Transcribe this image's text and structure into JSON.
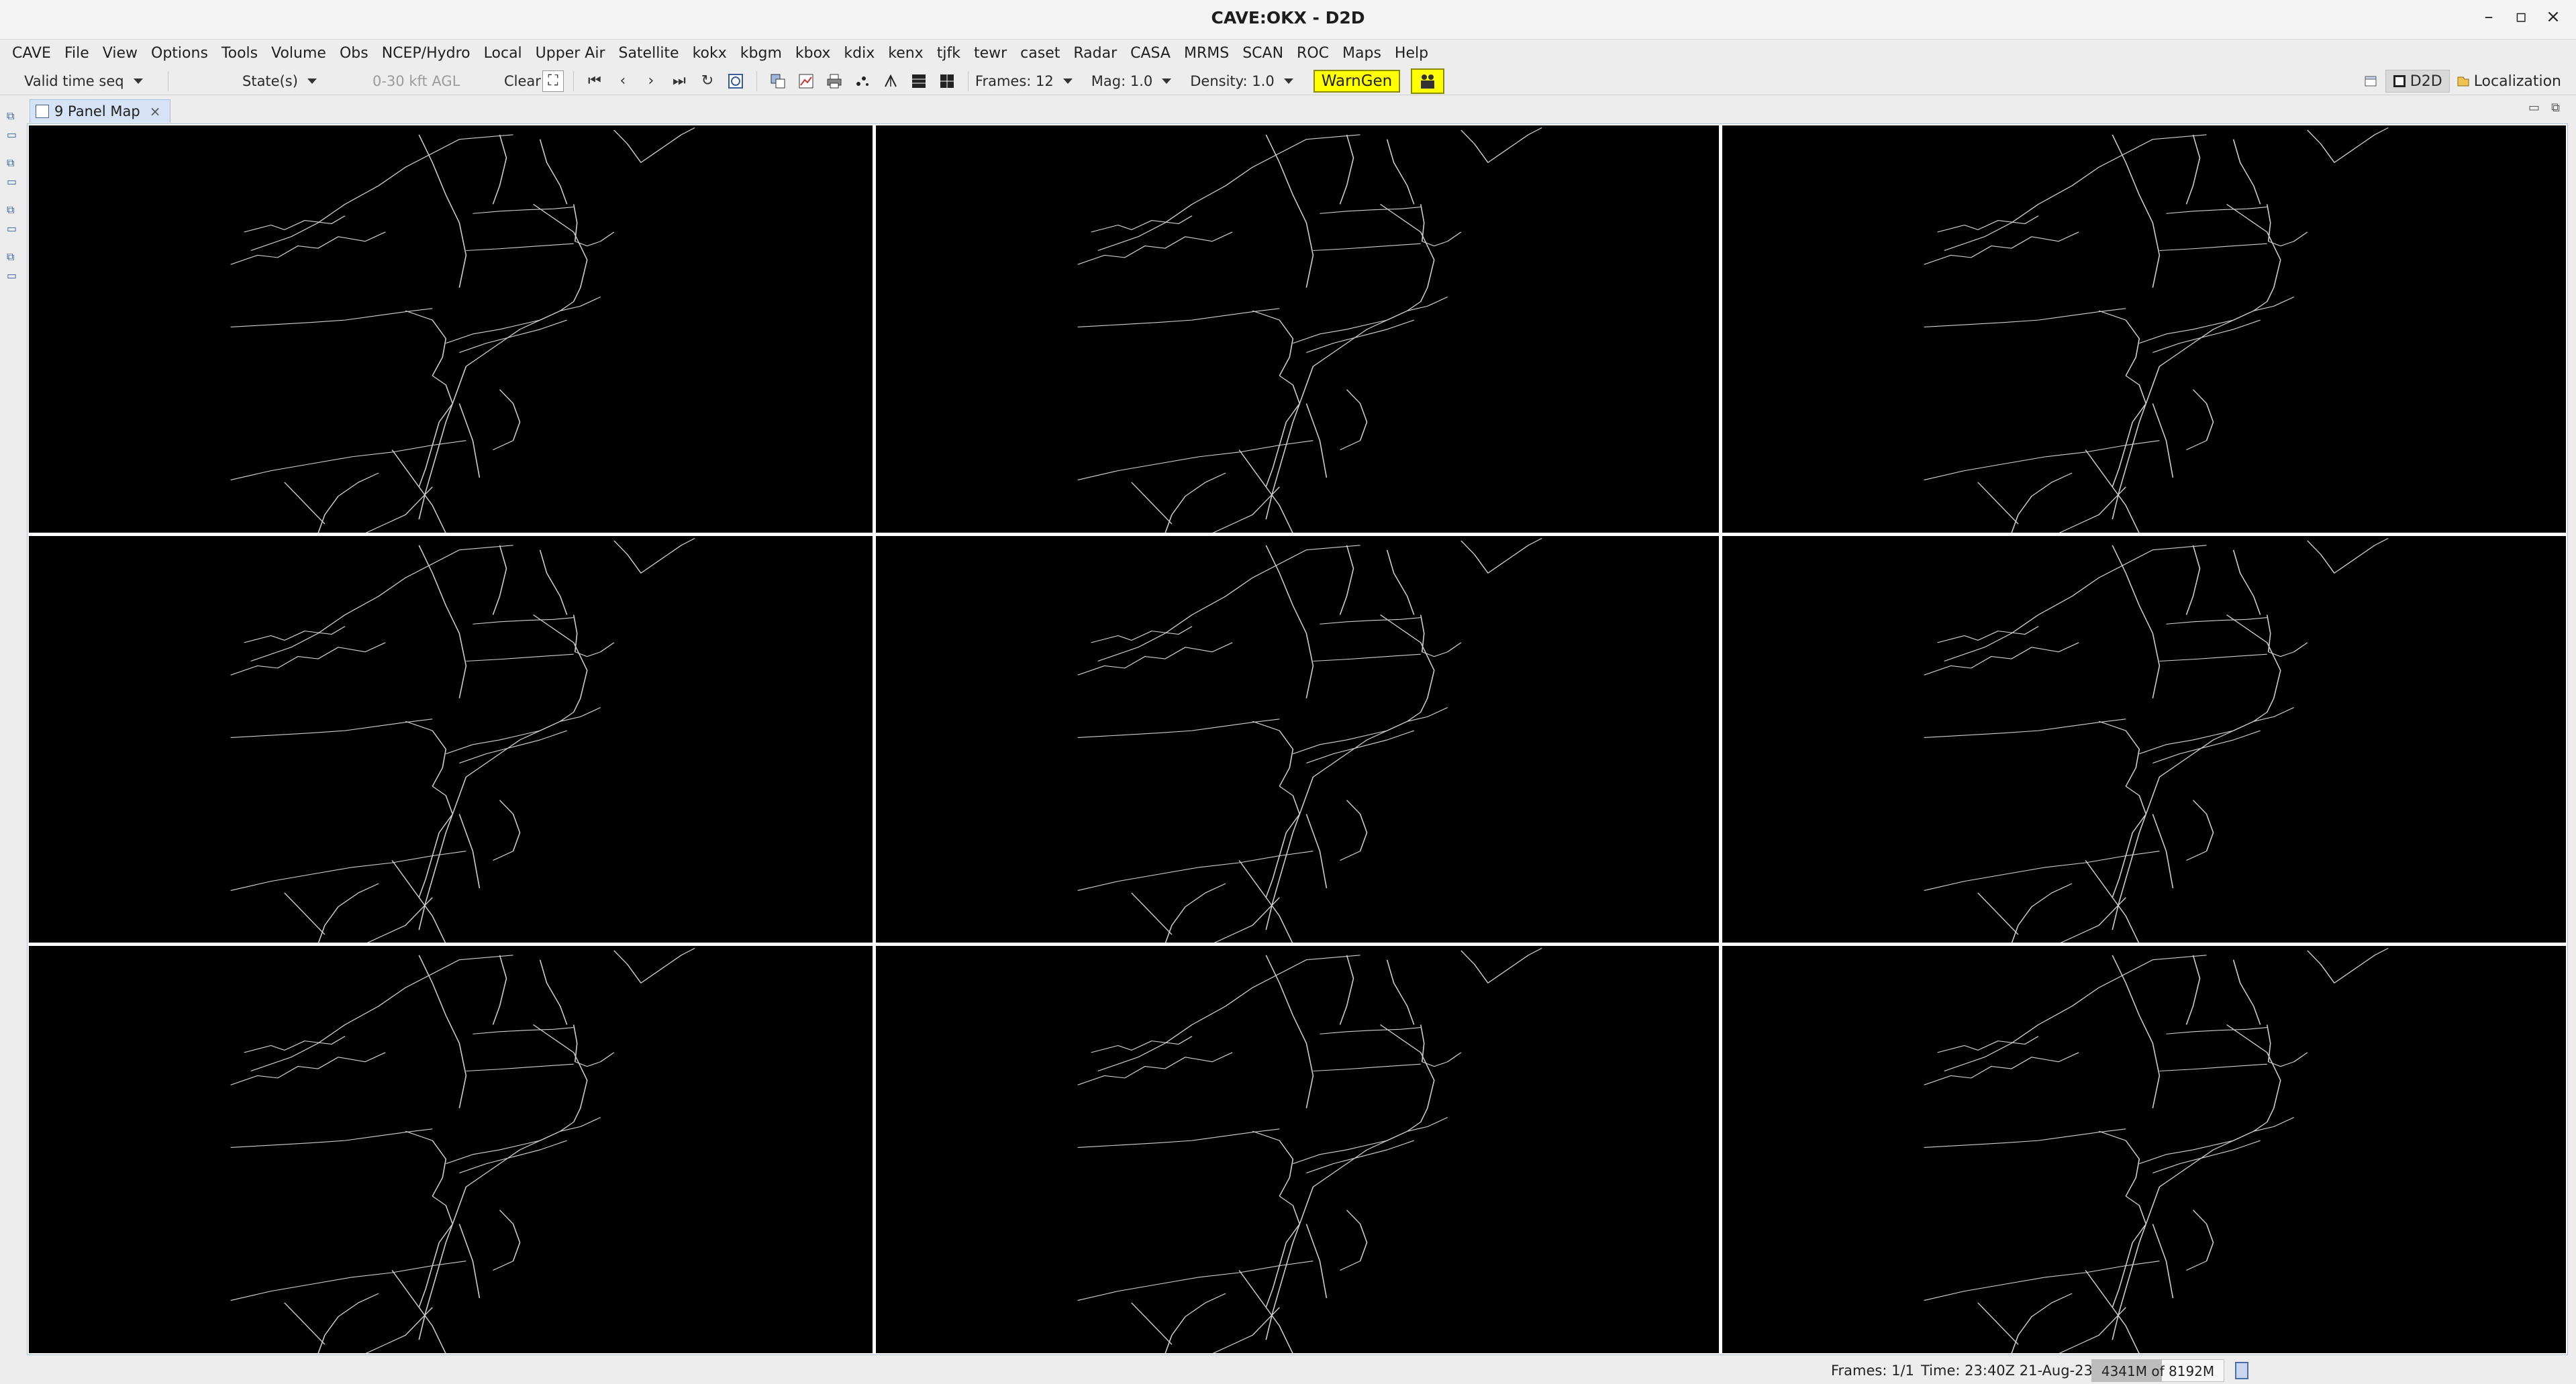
{
  "window": {
    "title": "CAVE:OKX - D2D",
    "minimize_glyph": "–",
    "maximize_glyph": "▫",
    "close_glyph": "×"
  },
  "menubar": {
    "items": [
      "CAVE",
      "File",
      "View",
      "Options",
      "Tools",
      "Volume",
      "Obs",
      "NCEP/Hydro",
      "Local",
      "Upper Air",
      "Satellite",
      "kokx",
      "kbgm",
      "kbox",
      "kdix",
      "kenx",
      "tjfk",
      "tewr",
      "caset",
      "Radar",
      "CASA",
      "MRMS",
      "SCAN",
      "ROC",
      "Maps",
      "Help"
    ]
  },
  "toolbar": {
    "time_match": "Valid time seq",
    "load_mode": "State(s)",
    "height_range": "0-30 kft AGL",
    "clear_label": "Clear",
    "frames_label": "Frames: 12",
    "mag_label": "Mag: 1.0",
    "density_label": "Density: 1.0",
    "warngen_label": "WarnGen",
    "icons": {
      "first_frame": "⏮",
      "prev_frame": "‹",
      "next_frame": "›",
      "last_frame": "⏭",
      "loop": "↻",
      "clear_icon": "⛶"
    }
  },
  "perspectives": {
    "d2d_label": "D2D",
    "localization_label": "Localization"
  },
  "tab": {
    "label": "9 Panel Map",
    "close_glyph": "×"
  },
  "panes": {
    "count": 9,
    "background": "#000000",
    "map_stroke": "#cfcfcf"
  },
  "status": {
    "frames": "Frames: 1/1",
    "time": "Time: 23:40Z 21-Aug-23",
    "heap_text": "4341M of 8192M",
    "heap_used_fraction": 0.53
  }
}
